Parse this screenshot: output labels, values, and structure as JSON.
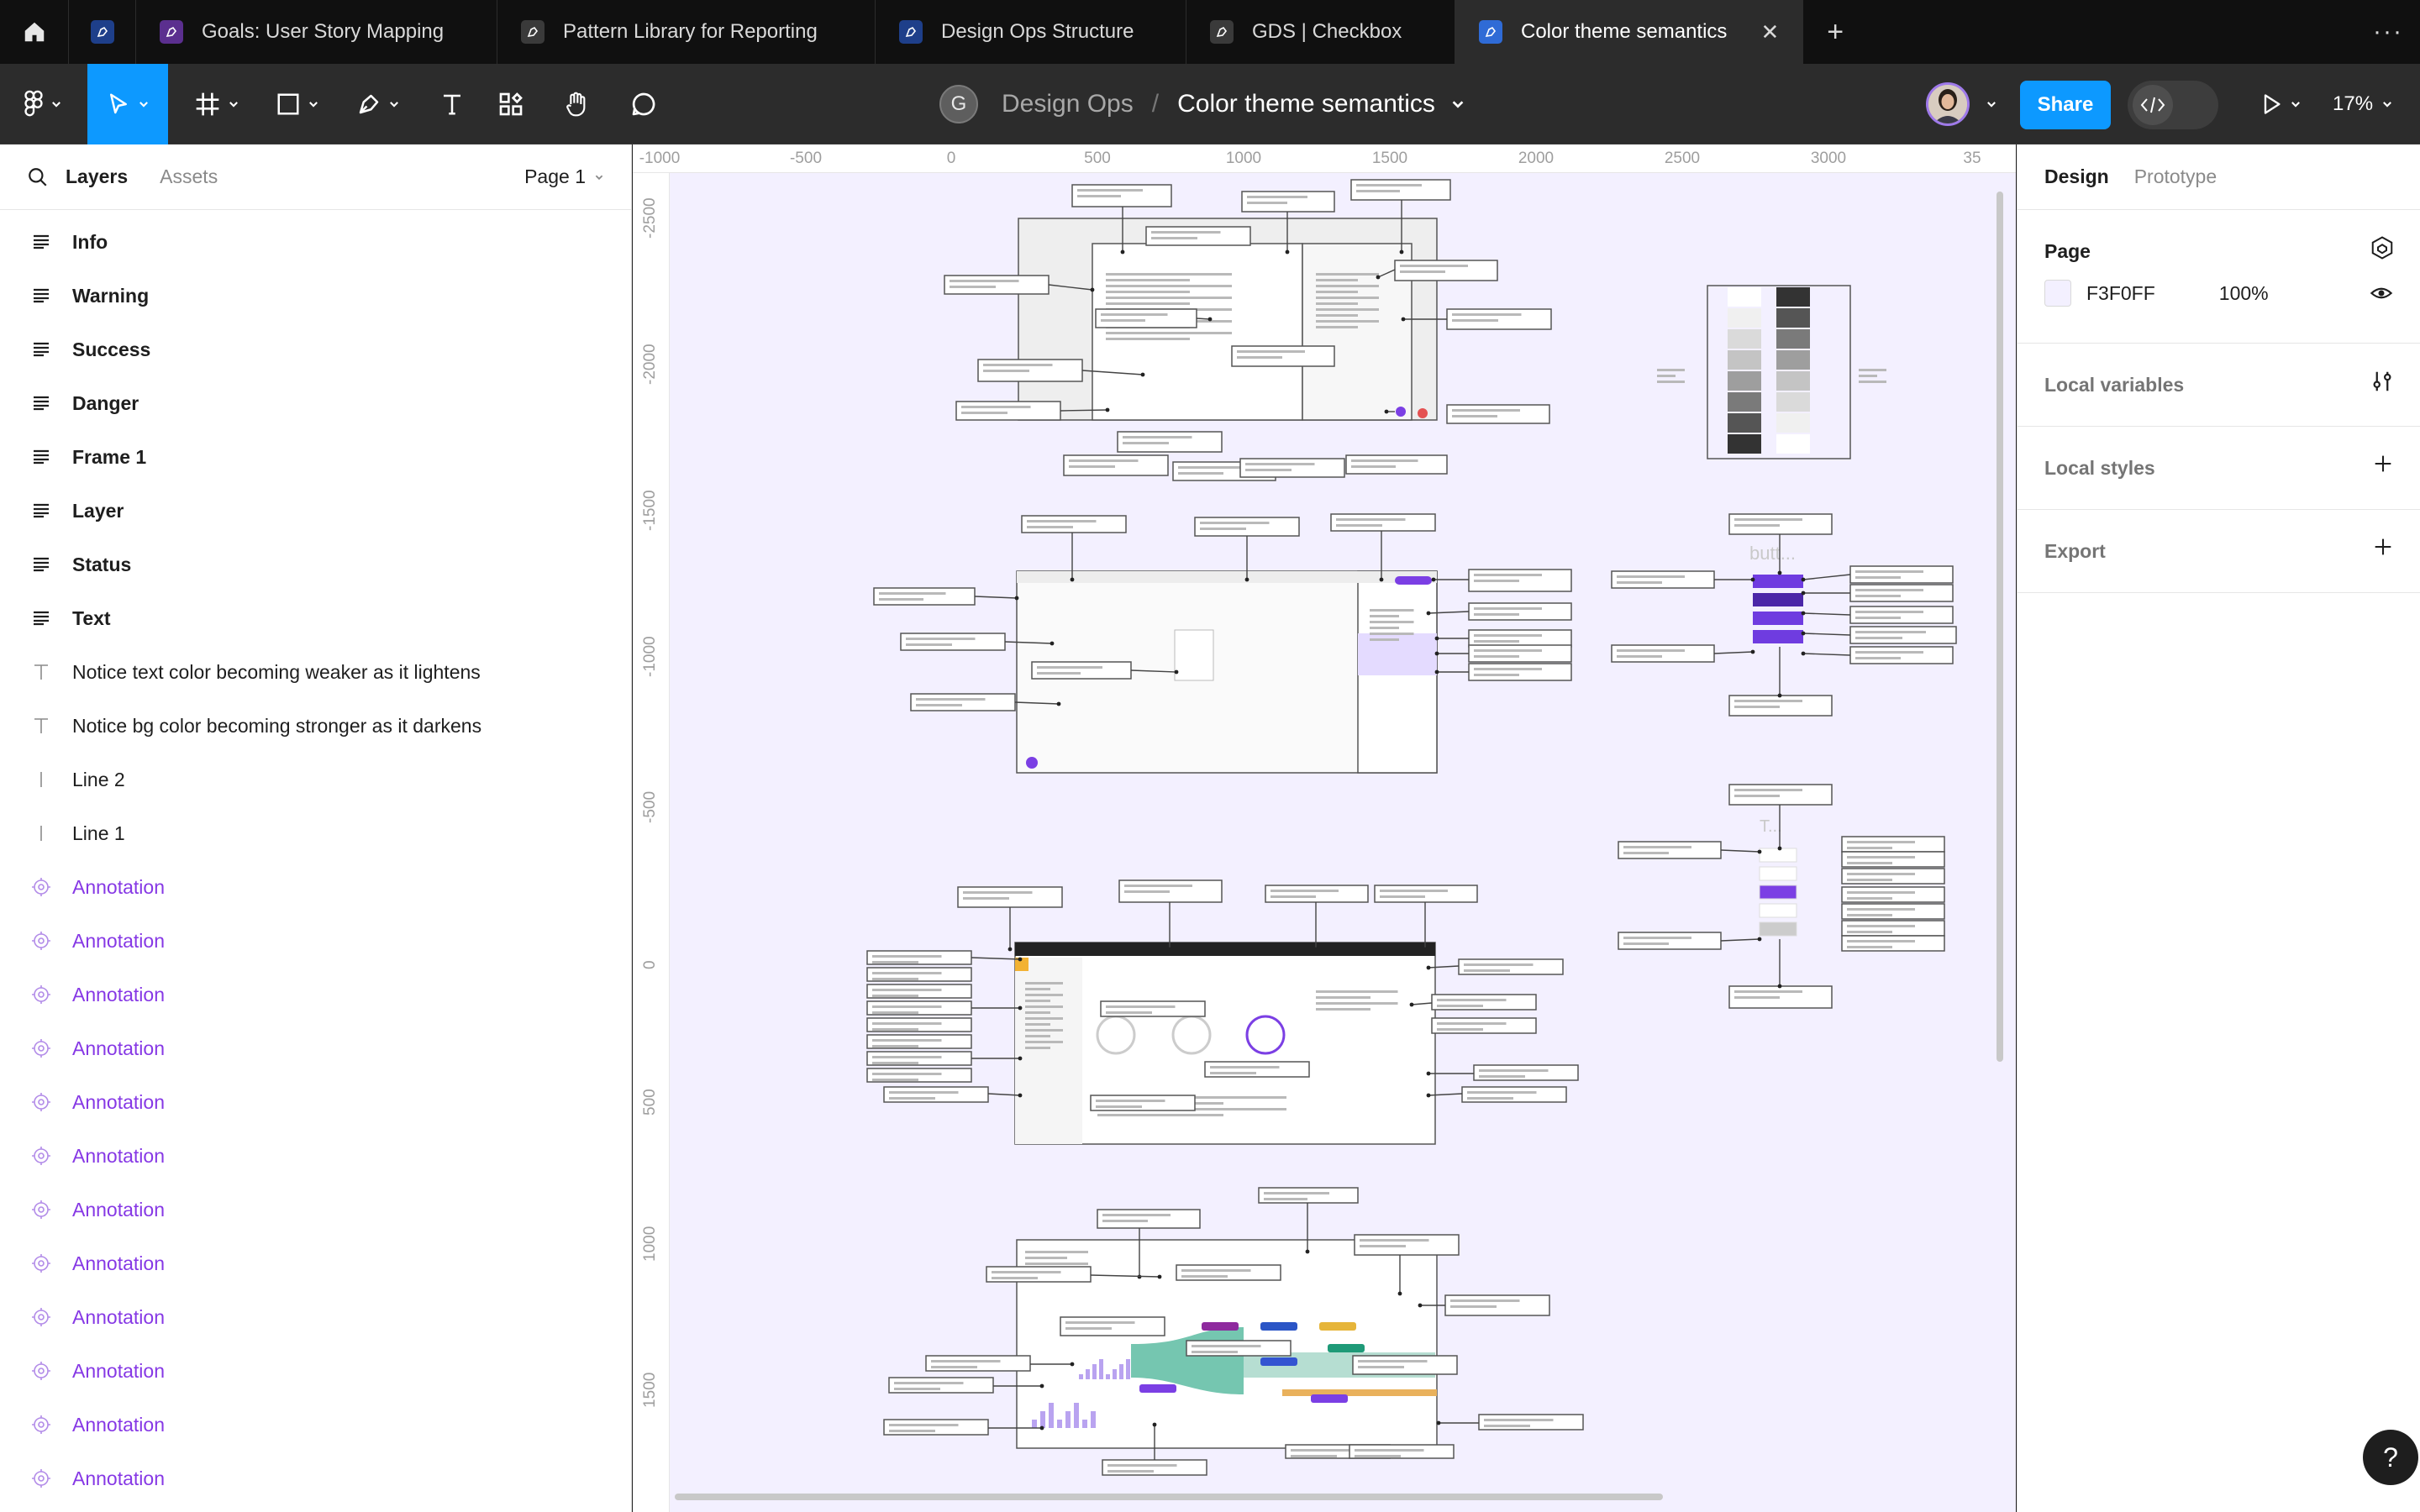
{
  "tabs": [
    {
      "label": "",
      "icon": "file-icon",
      "color": "#1e3f8a"
    },
    {
      "label": "Goals: User Story Mapping",
      "icon": "figjam-icon",
      "color": "#5b2f8f"
    },
    {
      "label": "Pattern Library for Reporting",
      "icon": "file-icon",
      "color": "#3a3a3a"
    },
    {
      "label": "Design Ops Structure",
      "icon": "file-icon",
      "color": "#1e3f8a"
    },
    {
      "label": "GDS | Checkbox",
      "icon": "file-icon",
      "color": "#3a3a3a"
    },
    {
      "label": "Color theme semantics",
      "icon": "file-icon",
      "color": "#2f6bd6",
      "active": true
    }
  ],
  "tab_close": "✕",
  "tab_add": "+",
  "tab_more": "···",
  "breadcrumb": {
    "team_initial": "G",
    "team": "Design Ops",
    "separator": "/",
    "file": "Color theme semantics"
  },
  "toolbar": {
    "share_label": "Share",
    "zoom": "17%"
  },
  "left_panel": {
    "layers_tab": "Layers",
    "assets_tab": "Assets",
    "page_selector": "Page 1",
    "layers": [
      {
        "name": "Info",
        "type": "frame"
      },
      {
        "name": "Warning",
        "type": "frame"
      },
      {
        "name": "Success",
        "type": "frame"
      },
      {
        "name": "Danger",
        "type": "frame"
      },
      {
        "name": "Frame 1",
        "type": "frame"
      },
      {
        "name": "Layer",
        "type": "frame"
      },
      {
        "name": "Status",
        "type": "frame"
      },
      {
        "name": "Text",
        "type": "frame"
      },
      {
        "name": "Notice text color becoming weaker as it lightens",
        "type": "text"
      },
      {
        "name": "Notice bg color becoming stronger as it darkens",
        "type": "text"
      },
      {
        "name": "Line 2",
        "type": "line"
      },
      {
        "name": "Line 1",
        "type": "line"
      },
      {
        "name": "Annotation",
        "type": "annotation"
      },
      {
        "name": "Annotation",
        "type": "annotation"
      },
      {
        "name": "Annotation",
        "type": "annotation"
      },
      {
        "name": "Annotation",
        "type": "annotation"
      },
      {
        "name": "Annotation",
        "type": "annotation"
      },
      {
        "name": "Annotation",
        "type": "annotation"
      },
      {
        "name": "Annotation",
        "type": "annotation"
      },
      {
        "name": "Annotation",
        "type": "annotation"
      },
      {
        "name": "Annotation",
        "type": "annotation"
      },
      {
        "name": "Annotation",
        "type": "annotation"
      },
      {
        "name": "Annotation",
        "type": "annotation"
      },
      {
        "name": "Annotation",
        "type": "annotation"
      }
    ]
  },
  "canvas": {
    "background": "#f3f0ff",
    "ruler_x": [
      "-1000",
      "-500",
      "0",
      "500",
      "1000",
      "1500",
      "2000",
      "2500",
      "3000",
      "35"
    ],
    "ruler_y": [
      "-2500",
      "-2000",
      "-1500",
      "-1000",
      "-500",
      "0",
      "500",
      "1000",
      "1500"
    ],
    "artboard_labels": [
      "butt...",
      "T..."
    ]
  },
  "right_panel": {
    "design_tab": "Design",
    "prototype_tab": "Prototype",
    "page_section": "Page",
    "page_color": "F3F0FF",
    "page_opacity": "100%",
    "local_variables": "Local variables",
    "local_styles": "Local styles",
    "export": "Export"
  },
  "help_label": "?",
  "colors": {
    "accent": "#0d99ff",
    "annotation": "#8638e5",
    "canvas": "#f3f0ff",
    "toolbar": "#2c2c2c"
  }
}
